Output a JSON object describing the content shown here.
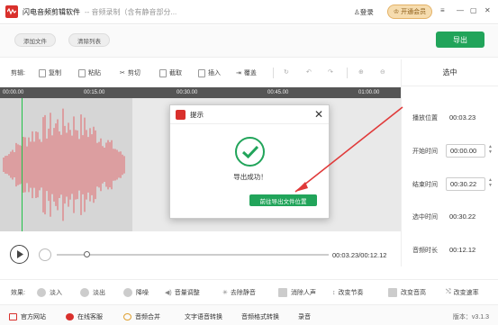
{
  "title": {
    "app_name": "闪电音频剪辑软件",
    "doc_title": "-- 音频录制（含有静音部分..."
  },
  "header": {
    "login_label": "登录",
    "vip_label": "开通会员"
  },
  "toolbar1": {
    "add_file": "添加文件",
    "clear_list": "清除列表",
    "export": "导出"
  },
  "toolbar2": {
    "label": "剪辑:",
    "copy": "复制",
    "paste": "粘贴",
    "cut": "剪切",
    "crop": "截取",
    "insert": "插入",
    "overwrite": "覆盖"
  },
  "ruler": {
    "t0": "00:00.00",
    "t1": "00:15.00",
    "t2": "00:30.00",
    "t3": "00:45.00",
    "t4": "01:00.00"
  },
  "right_panel": {
    "title": "选中",
    "play_position_label": "播放位置",
    "play_position": "00:03.23",
    "start_label": "开始时间",
    "start": "00:00.00",
    "end_label": "结束时间",
    "end": "00:30.22",
    "selected_label": "选中时间",
    "selected": "00:30.22",
    "duration_label": "音频时长",
    "duration": "00:12.12"
  },
  "player": {
    "time": "00:03.23/00:12.12",
    "progress": 0.11
  },
  "effects": {
    "label": "效果:",
    "items": [
      "淡入",
      "淡出",
      "降噪",
      "音量调整",
      "去除静音",
      "消除人声",
      "改变节奏",
      "改变音高",
      "改变速率"
    ]
  },
  "footer": {
    "site": "官方网站",
    "support": "在线客服",
    "merge": "音频合并",
    "tts": "文字语音转换",
    "convert": "音频格式转换",
    "record": "录音",
    "version": "版本：v3.1.3"
  },
  "modal": {
    "title": "提示",
    "message": "导出成功！",
    "button": "前往导出文件位置"
  },
  "colors": {
    "accent": "#21a45a",
    "brand": "#d9302c",
    "wave": "#e2656a",
    "playhead": "#21c24a"
  }
}
